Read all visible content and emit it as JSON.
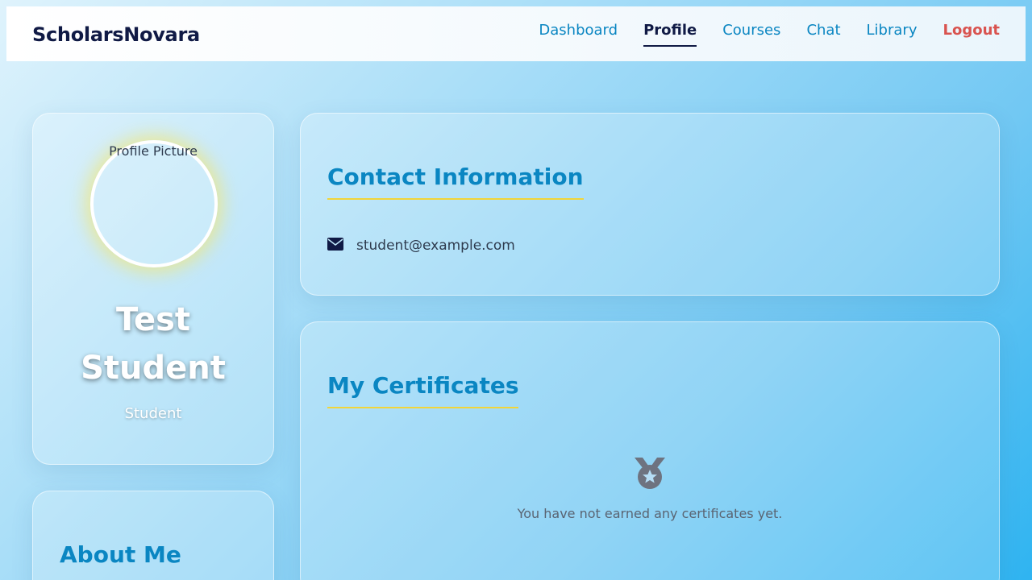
{
  "header": {
    "brand": "ScholarsNovara",
    "nav": [
      {
        "label": "Dashboard"
      },
      {
        "label": "Profile"
      },
      {
        "label": "Courses"
      },
      {
        "label": "Chat"
      },
      {
        "label": "Library"
      },
      {
        "label": "Logout"
      }
    ]
  },
  "profile": {
    "avatar_alt": "Profile Picture",
    "name": "Test Student",
    "role": "Student"
  },
  "about": {
    "title": "About Me"
  },
  "contact": {
    "title": "Contact Information",
    "email": "student@example.com"
  },
  "certificates": {
    "title": "My Certificates",
    "empty_message": "You have not earned any certificates yet."
  },
  "colors": {
    "brand": "#101a45",
    "link": "#0a86c2",
    "logout": "#d9534f",
    "accent_underline": "#f1d53a"
  },
  "icons": {
    "contact_email": "envelope-icon",
    "certificate_empty": "medal-icon"
  }
}
